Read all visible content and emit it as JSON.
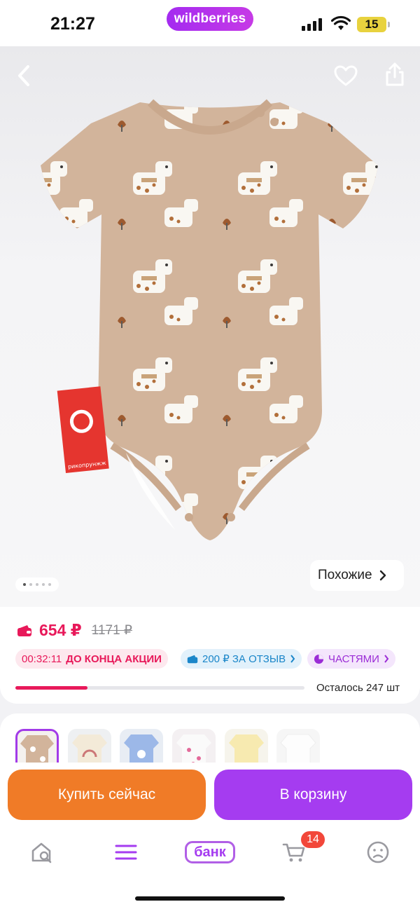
{
  "status_bar": {
    "time": "21:27",
    "app_brand": "wildberries",
    "battery": "15",
    "battery_color": "#e8d23e"
  },
  "product_gallery": {
    "image_description_icon": "product-photo",
    "brand_tag_text": "рикопрунжж",
    "similar_label": "Похожие",
    "current_image": 1,
    "total_images": 5
  },
  "price": {
    "current": "654 ₽",
    "old": "1171 ₽",
    "accent_color": "#e8195a"
  },
  "chips": {
    "timer_value": "00:32:11",
    "timer_label": "ДО КОНЦА АКЦИИ",
    "review_label": "200 ₽ ЗА ОТЗЫВ",
    "parts_label": "ЧАСТЯМИ"
  },
  "stock": {
    "left_label": "Осталось 247 шт",
    "progress_fraction": 0.25
  },
  "variants": {
    "count_visible": 6,
    "selected_index": 0
  },
  "actions": {
    "buy_now": "Купить сейчас",
    "add_to_cart": "В корзину",
    "buy_color": "#f07b27",
    "cart_color": "#a53cf0"
  },
  "tabbar": {
    "bank_label": "банк",
    "cart_badge": "14",
    "items": [
      "home-search-icon",
      "menu-icon",
      "bank",
      "cart-icon",
      "profile-icon"
    ]
  }
}
